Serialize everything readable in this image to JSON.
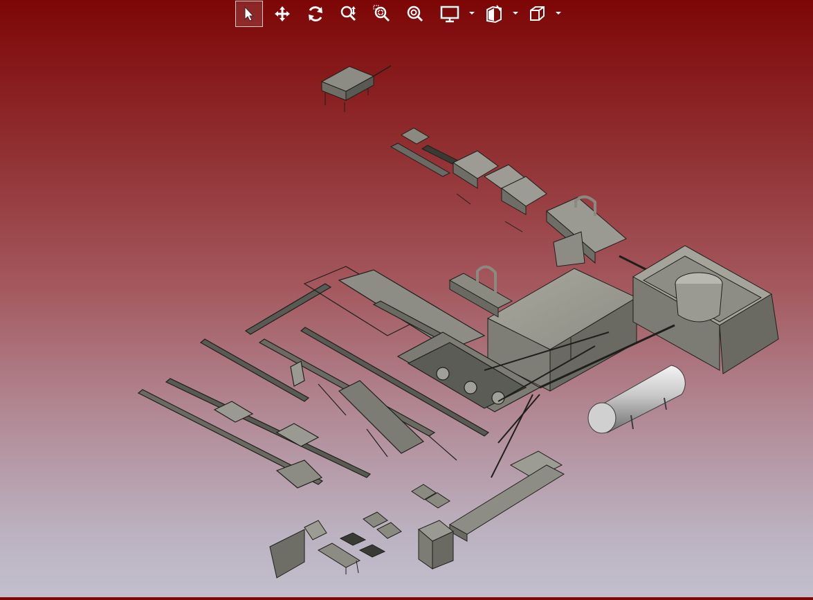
{
  "window": {
    "title": ""
  },
  "toolbar": {
    "buttons": [
      {
        "id": "select",
        "icon": "cursor-arrow-icon",
        "active": true
      },
      {
        "id": "pan",
        "icon": "move-arrows-icon",
        "active": false
      },
      {
        "id": "rotate",
        "icon": "rotate-icon",
        "active": false
      },
      {
        "id": "zoom-dynamic",
        "icon": "zoom-updown-icon",
        "active": false
      },
      {
        "id": "zoom-window",
        "icon": "zoom-window-icon",
        "active": false
      },
      {
        "id": "zoom-fit",
        "icon": "zoom-fit-icon",
        "active": false
      },
      {
        "id": "display-mode",
        "icon": "monitor-icon",
        "active": false,
        "dropdown": true
      },
      {
        "id": "section",
        "icon": "section-plane-icon",
        "active": false,
        "dropdown": true
      },
      {
        "id": "view-orientation",
        "icon": "cube-view-icon",
        "active": false,
        "dropdown": true
      }
    ]
  },
  "colors": {
    "background_top": "#7d0606",
    "background_bottom": "#c2bfcc",
    "machine_fill": "#8a8a80",
    "machine_dark": "#2a2a26",
    "tank": "#d8d8d8"
  },
  "scene": {
    "description_icons": [
      "factory-layout-3d-model"
    ]
  }
}
